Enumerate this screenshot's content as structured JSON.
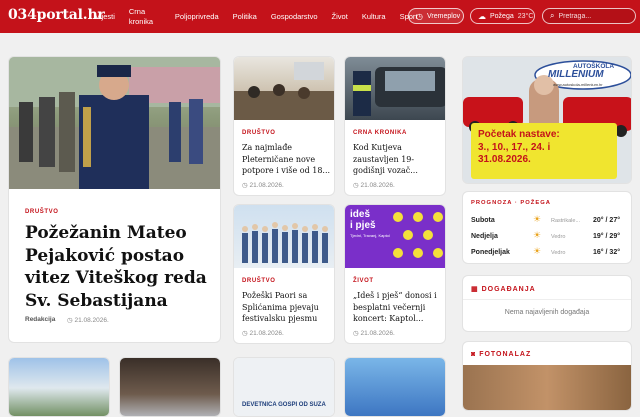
{
  "site": {
    "logo": "034portal.hr"
  },
  "nav": {
    "items": [
      "Vijesti",
      "Crna kronika",
      "Poljoprivreda",
      "Politika",
      "Gospodarstvo",
      "Život",
      "Kultura",
      "Sport"
    ]
  },
  "header": {
    "weather_button": "Vremeplov",
    "city": "Požega",
    "temp": "23°C",
    "search_placeholder": "Pretraga..."
  },
  "featured": {
    "category": "DRUŠTVO",
    "title": "Požežanin Mateo Pejaković postao vitez Viteškog reda Sv. Sebastijana",
    "author": "Redakcija",
    "date": "21.08.2026."
  },
  "articles": [
    {
      "category": "DRUŠTVO",
      "title": "Za najmlađe Pleterničane nove potpore i više od 18...",
      "date": "21.08.2026."
    },
    {
      "category": "CRNA KRONIKA",
      "title": "Kod Kutjeva zaustavljen 19-godišnji vozač...",
      "date": "21.08.2026."
    },
    {
      "category": "DRUŠTVO",
      "title": "Požeški Paori sa Splićanima pjevaju festivalsku pjesmu",
      "date": "21.08.2026."
    },
    {
      "category": "ŽIVOT",
      "title": "„Ideš i pješ“ donosi i besplatni večernji koncert: Kaptol...",
      "date": "21.08.2026."
    }
  ],
  "ad": {
    "brand": "AUTOŠKOLA",
    "name": "MILLENIUM",
    "url": "www.autoskola-millenium.hr",
    "line1": "Početak nastave:",
    "line2": "3., 10., 17., 24. i",
    "line3": "31.08.2026."
  },
  "poster": {
    "line1": "ideš",
    "line2": "i pješ",
    "sub": "Tjedni, Travanj, Kaptol"
  },
  "forecast": {
    "heading": "PROGNOZA · POŽEGA",
    "days": [
      {
        "day": "Subota",
        "desc": "Rastrikale...",
        "temps": "20° / 27°"
      },
      {
        "day": "Nedjelja",
        "desc": "Vedro",
        "temps": "19° / 29°"
      },
      {
        "day": "Ponedjeljak",
        "desc": "Vedro",
        "temps": "16° / 32°"
      }
    ]
  },
  "events": {
    "heading": "DOGAĐANJA",
    "empty": "Nema najavljenih događaja"
  },
  "photo": {
    "heading": "FOTONALAZ"
  },
  "bottom": {
    "devetnica": "DEVETNICA GOSPI OD SUZA"
  },
  "colors": {
    "brand": "#c4121a"
  }
}
